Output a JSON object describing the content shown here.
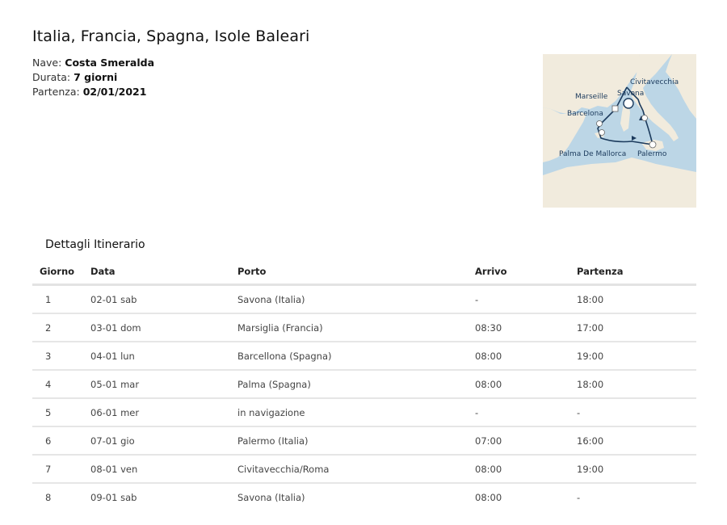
{
  "header": {
    "title": "Italia, Francia, Spagna, Isole Baleari",
    "ship_label": "Nave:",
    "ship_value": "Costa Smeralda",
    "duration_label": "Durata:",
    "duration_value": "7 giorni",
    "departure_label": "Partenza:",
    "departure_value": "02/01/2021"
  },
  "map": {
    "labels": {
      "civitavecchia": "Civitavecchia",
      "savona": "Savona",
      "marseille": "Marseille",
      "barcelona": "Barcelona",
      "palma": "Palma De Mallorca",
      "palermo": "Palermo"
    },
    "colors": {
      "sea": "#bcd6e6",
      "land": "#f1ebdd",
      "route": "#1b3a5c"
    }
  },
  "itinerary": {
    "title": "Dettagli Itinerario",
    "columns": [
      "Giorno",
      "Data",
      "Porto",
      "Arrivo",
      "Partenza"
    ],
    "rows": [
      [
        "1",
        "02-01 sab",
        "Savona (Italia)",
        "-",
        "18:00"
      ],
      [
        "2",
        "03-01 dom",
        "Marsiglia (Francia)",
        "08:30",
        "17:00"
      ],
      [
        "3",
        "04-01 lun",
        "Barcellona (Spagna)",
        "08:00",
        "19:00"
      ],
      [
        "4",
        "05-01 mar",
        "Palma (Spagna)",
        "08:00",
        "18:00"
      ],
      [
        "5",
        "06-01 mer",
        "in navigazione",
        "-",
        "-"
      ],
      [
        "6",
        "07-01 gio",
        "Palermo (Italia)",
        "07:00",
        "16:00"
      ],
      [
        "7",
        "08-01 ven",
        "Civitavecchia/Roma",
        "08:00",
        "19:00"
      ],
      [
        "8",
        "09-01 sab",
        "Savona (Italia)",
        "08:00",
        "-"
      ]
    ]
  }
}
